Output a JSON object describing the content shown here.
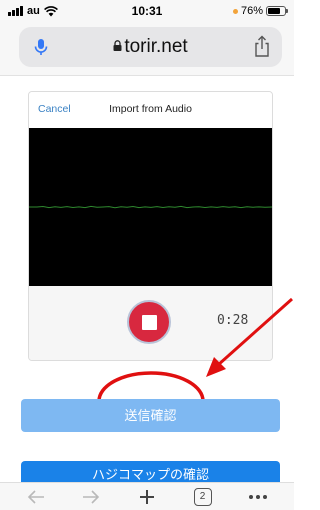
{
  "status_bar": {
    "carrier": "au",
    "time": "10:31",
    "battery_percent_label": "76%",
    "battery_level": 0.76,
    "indicator_color": "#f2a33a"
  },
  "address_bar": {
    "url": "torir.net",
    "icons": [
      "microphone-icon",
      "lock-icon",
      "share-icon"
    ],
    "accent": "#3478f6"
  },
  "dialog": {
    "cancel_label": "Cancel",
    "title": "Import from Audio",
    "timer": "0:28",
    "stop_color": "#d8283f"
  },
  "buttons": {
    "confirm_label": "送信確認",
    "bottom_label": "ハジコマップの確認",
    "confirm_color": "#7eb8f2",
    "bottom_color": "#1a82e8"
  },
  "annotation": {
    "color": "#e01010"
  },
  "toolbar": {
    "tab_count": "2",
    "icons": [
      "back-arrow-icon",
      "forward-arrow-icon",
      "new-tab-plus-icon",
      "tabs-icon",
      "more-icon"
    ]
  }
}
